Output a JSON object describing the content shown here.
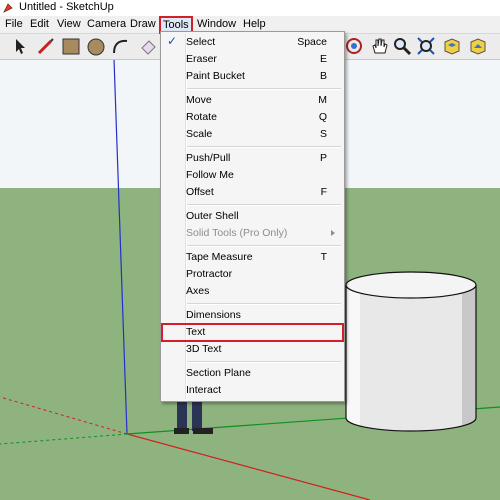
{
  "window": {
    "title": "Untitled - SketchUp",
    "icon": "sketchup-logo-icon"
  },
  "menubar": {
    "items": [
      {
        "label": "File"
      },
      {
        "label": "Edit"
      },
      {
        "label": "View"
      },
      {
        "label": "Camera"
      },
      {
        "label": "Draw"
      },
      {
        "label": "Tools",
        "active": true
      },
      {
        "label": "Window"
      },
      {
        "label": "Help"
      }
    ]
  },
  "toolbar": {
    "tools": [
      "select-arrow-icon",
      "pencil-line-icon",
      "rectangle-icon",
      "circle-icon",
      "arc-icon",
      "eraser-icon",
      "orbit-icon",
      "pan-hand-icon",
      "zoom-magnifier-icon",
      "zoom-extents-icon",
      "previous-view-icon",
      "next-view-icon"
    ]
  },
  "tools_menu": {
    "items": [
      {
        "label": "Select",
        "shortcut": "Space",
        "checked": true
      },
      {
        "label": "Eraser",
        "shortcut": "E"
      },
      {
        "label": "Paint Bucket",
        "shortcut": "B"
      },
      {
        "label": "Move",
        "shortcut": "M"
      },
      {
        "label": "Rotate",
        "shortcut": "Q"
      },
      {
        "label": "Scale",
        "shortcut": "S"
      },
      {
        "label": "Push/Pull",
        "shortcut": "P"
      },
      {
        "label": "Follow Me",
        "shortcut": ""
      },
      {
        "label": "Offset",
        "shortcut": "F"
      },
      {
        "label": "Outer Shell",
        "shortcut": ""
      },
      {
        "label": "Solid Tools (Pro Only)",
        "shortcut": "",
        "disabled": true,
        "submenu": true
      },
      {
        "label": "Tape Measure",
        "shortcut": "T"
      },
      {
        "label": "Protractor",
        "shortcut": ""
      },
      {
        "label": "Axes",
        "shortcut": ""
      },
      {
        "label": "Dimensions",
        "shortcut": ""
      },
      {
        "label": "Text",
        "shortcut": "",
        "highlighted": true
      },
      {
        "label": "3D Text",
        "shortcut": ""
      },
      {
        "label": "Section Plane",
        "shortcut": ""
      },
      {
        "label": "Interact",
        "shortcut": ""
      }
    ]
  },
  "colors": {
    "ground": "#8fb37f",
    "sky": "#f3f6f8",
    "highlight_red": "#d0202a",
    "axis_blue": "#2430c8",
    "axis_red": "#d02020",
    "axis_green": "#109020"
  }
}
